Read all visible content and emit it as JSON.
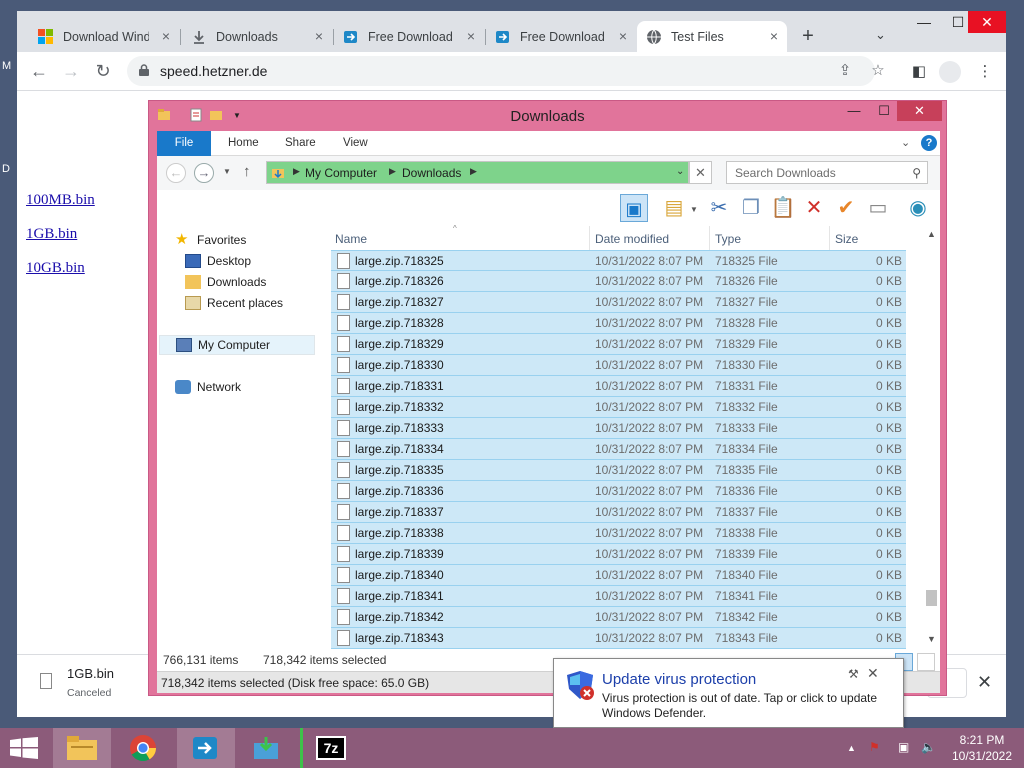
{
  "desktop": {
    "glyph_left": "M",
    "glyph_left2": "D"
  },
  "browser": {
    "tabs": [
      {
        "label": "Download Wind",
        "icon": "windows-logo-icon"
      },
      {
        "label": "Downloads",
        "icon": "download-icon"
      },
      {
        "label": "Free Download |",
        "icon": "app-icon"
      },
      {
        "label": "Free Download |",
        "icon": "app-icon"
      },
      {
        "label": "Test Files",
        "icon": "globe-icon"
      }
    ],
    "new_tab": "+",
    "tab_menu": "⌄",
    "window_controls": {
      "minimize": "—",
      "maximize": "☐",
      "close": "✕"
    },
    "url": "speed.hetzner.de",
    "page_links": [
      "100MB.bin",
      "1GB.bin",
      "10GB.bin"
    ],
    "download": {
      "filename": "1GB.bin",
      "status": "Canceled"
    }
  },
  "explorer": {
    "title": "Downloads",
    "ribbon_tabs": [
      "File",
      "Home",
      "Share",
      "View"
    ],
    "help": "?",
    "breadcrumb": [
      "My Computer",
      "Downloads"
    ],
    "search_placeholder": "Search Downloads",
    "nav": {
      "favorites": "Favorites",
      "favorites_items": [
        "Desktop",
        "Downloads",
        "Recent places"
      ],
      "computer": "My Computer",
      "network": "Network"
    },
    "columns": [
      "Name",
      "Date modified",
      "Type",
      "Size"
    ],
    "rows": [
      {
        "name": "large.zip.718325",
        "date": "10/31/2022 8:07 PM",
        "type": "718325 File",
        "size": "0 KB"
      },
      {
        "name": "large.zip.718326",
        "date": "10/31/2022 8:07 PM",
        "type": "718326 File",
        "size": "0 KB"
      },
      {
        "name": "large.zip.718327",
        "date": "10/31/2022 8:07 PM",
        "type": "718327 File",
        "size": "0 KB"
      },
      {
        "name": "large.zip.718328",
        "date": "10/31/2022 8:07 PM",
        "type": "718328 File",
        "size": "0 KB"
      },
      {
        "name": "large.zip.718329",
        "date": "10/31/2022 8:07 PM",
        "type": "718329 File",
        "size": "0 KB"
      },
      {
        "name": "large.zip.718330",
        "date": "10/31/2022 8:07 PM",
        "type": "718330 File",
        "size": "0 KB"
      },
      {
        "name": "large.zip.718331",
        "date": "10/31/2022 8:07 PM",
        "type": "718331 File",
        "size": "0 KB"
      },
      {
        "name": "large.zip.718332",
        "date": "10/31/2022 8:07 PM",
        "type": "718332 File",
        "size": "0 KB"
      },
      {
        "name": "large.zip.718333",
        "date": "10/31/2022 8:07 PM",
        "type": "718333 File",
        "size": "0 KB"
      },
      {
        "name": "large.zip.718334",
        "date": "10/31/2022 8:07 PM",
        "type": "718334 File",
        "size": "0 KB"
      },
      {
        "name": "large.zip.718335",
        "date": "10/31/2022 8:07 PM",
        "type": "718335 File",
        "size": "0 KB"
      },
      {
        "name": "large.zip.718336",
        "date": "10/31/2022 8:07 PM",
        "type": "718336 File",
        "size": "0 KB"
      },
      {
        "name": "large.zip.718337",
        "date": "10/31/2022 8:07 PM",
        "type": "718337 File",
        "size": "0 KB"
      },
      {
        "name": "large.zip.718338",
        "date": "10/31/2022 8:07 PM",
        "type": "718338 File",
        "size": "0 KB"
      },
      {
        "name": "large.zip.718339",
        "date": "10/31/2022 8:07 PM",
        "type": "718339 File",
        "size": "0 KB"
      },
      {
        "name": "large.zip.718340",
        "date": "10/31/2022 8:07 PM",
        "type": "718340 File",
        "size": "0 KB"
      },
      {
        "name": "large.zip.718341",
        "date": "10/31/2022 8:07 PM",
        "type": "718341 File",
        "size": "0 KB"
      },
      {
        "name": "large.zip.718342",
        "date": "10/31/2022 8:07 PM",
        "type": "718342 File",
        "size": "0 KB"
      },
      {
        "name": "large.zip.718343",
        "date": "10/31/2022 8:07 PM",
        "type": "718343 File",
        "size": "0 KB"
      }
    ],
    "status_count": "766,131 items",
    "status_selected": "718,342 items selected",
    "details": "718,342 items selected (Disk free space: 65.0 GB)"
  },
  "notification": {
    "title": "Update virus protection",
    "body": "Virus protection is out of date. Tap or click to update Windows Defender."
  },
  "taskbar": {
    "clock_time": "8:21 PM",
    "clock_date": "10/31/2022",
    "sevenzip_label": "7z"
  },
  "colors": {
    "window_frame": "#e1749b",
    "selection": "#cde8f7",
    "taskbar": "#8c5b7a",
    "address_bar": "#7ed38b"
  }
}
